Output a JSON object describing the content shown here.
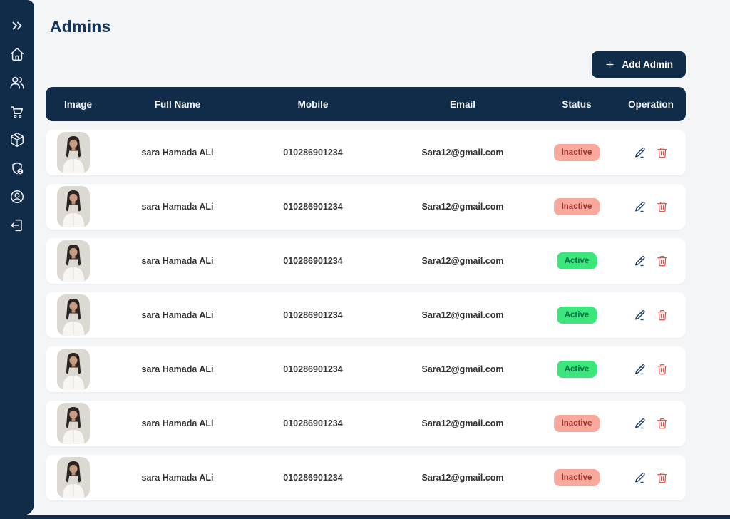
{
  "sidebar": {
    "icons": [
      {
        "name": "expand-double-chevron"
      },
      {
        "name": "home"
      },
      {
        "name": "users"
      },
      {
        "name": "shopping-cart"
      },
      {
        "name": "package"
      },
      {
        "name": "shield-admin"
      },
      {
        "name": "user-profile"
      },
      {
        "name": "logout"
      }
    ]
  },
  "header": {
    "title": "Admins"
  },
  "toolbar": {
    "add_admin_label": "Add Admin",
    "add_icon": "plus"
  },
  "table": {
    "columns": [
      "Image",
      "Full Name",
      "Mobile",
      "Email",
      "Status",
      "Operation"
    ],
    "rows": [
      {
        "full_name": "sara Hamada ALi",
        "mobile": "010286901234",
        "email": "Sara12@gmail.com",
        "status": "Inactive",
        "image": "woman-portrait"
      },
      {
        "full_name": "sara Hamada ALi",
        "mobile": "010286901234",
        "email": "Sara12@gmail.com",
        "status": "Inactive",
        "image": "woman-portrait"
      },
      {
        "full_name": "sara Hamada ALi",
        "mobile": "010286901234",
        "email": "Sara12@gmail.com",
        "status": "Active",
        "image": "woman-portrait"
      },
      {
        "full_name": "sara Hamada ALi",
        "mobile": "010286901234",
        "email": "Sara12@gmail.com",
        "status": "Active",
        "image": "woman-portrait"
      },
      {
        "full_name": "sara Hamada ALi",
        "mobile": "010286901234",
        "email": "Sara12@gmail.com",
        "status": "Active",
        "image": "woman-portrait"
      },
      {
        "full_name": "sara Hamada ALi",
        "mobile": "010286901234",
        "email": "Sara12@gmail.com",
        "status": "Inactive",
        "image": "woman-portrait"
      },
      {
        "full_name": "sara Hamada ALi",
        "mobile": "010286901234",
        "email": "Sara12@gmail.com",
        "status": "Inactive",
        "image": "woman-portrait"
      }
    ],
    "operations": [
      "edit",
      "delete"
    ]
  },
  "colors": {
    "navy": "#112C48",
    "page_bg": "#F4F5F6",
    "active_bg": "#3BE77B",
    "active_text": "#116A4E",
    "inactive_bg": "#F8A89D",
    "inactive_text": "#A13529",
    "edit_icon": "#1B3E63",
    "delete_icon": "#E2574C"
  }
}
